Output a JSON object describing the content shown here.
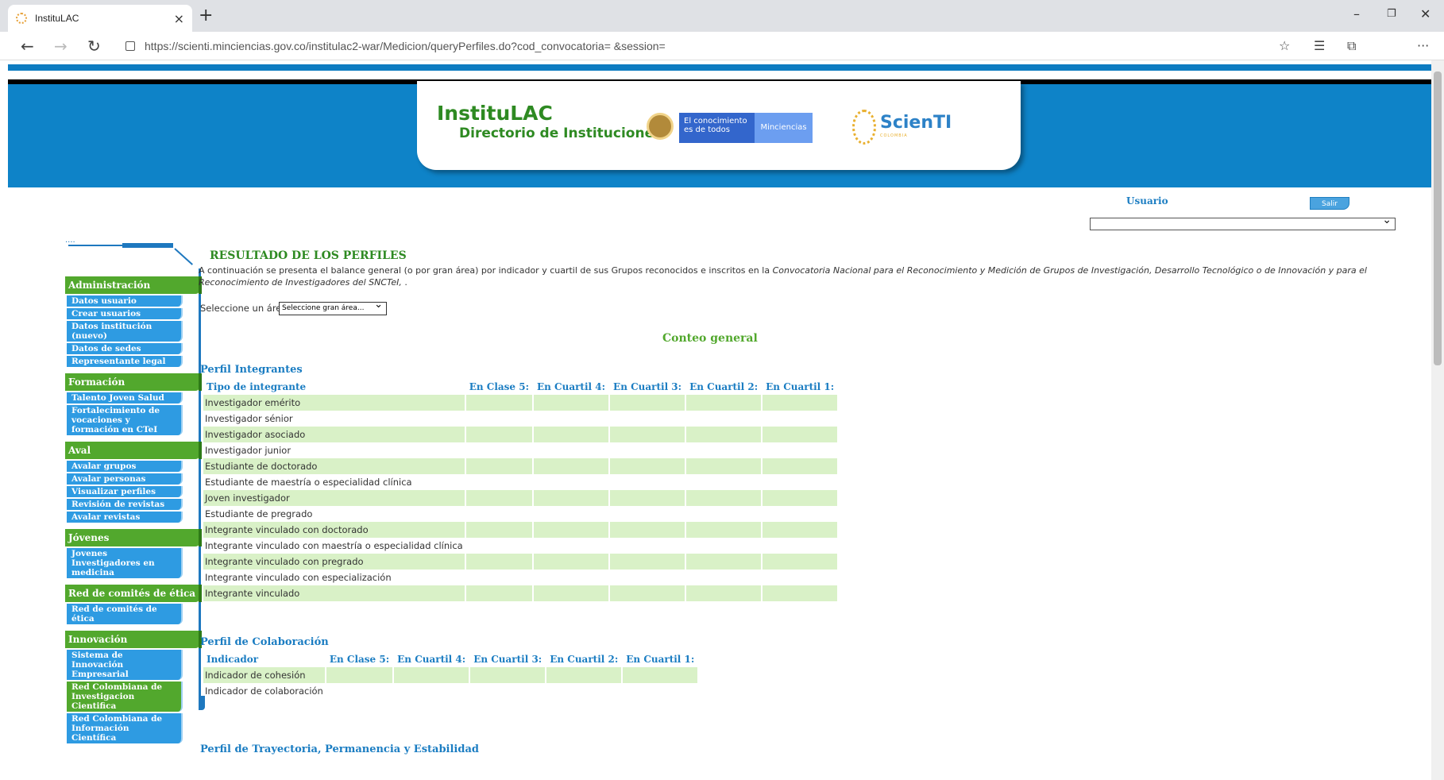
{
  "browser": {
    "tab_title": "InstituLAC",
    "tab_close": "×",
    "new_tab": "+",
    "url": "https://scienti.minciencias.gov.co/institulac2-war/Medicion/queryPerfiles.do?cod_convocatoria=    &session=",
    "back": "←",
    "forward": "→",
    "reload": "↻",
    "minimize": "–",
    "restore": "❐",
    "close": "✕",
    "more": "···"
  },
  "header": {
    "logo_main": "InstituLAC",
    "logo_sub": "Directorio de Instituciones",
    "gov_text": "El conocimiento es de todos",
    "gov_brand": "Minciencias",
    "scienti": "ScienTI",
    "scienti_sub": "COLOMBIA"
  },
  "user": {
    "label": "Usuario",
    "logout": "Salir",
    "select_value": ""
  },
  "sidebar": {
    "sections": [
      {
        "title": "Administración",
        "items": [
          {
            "label": "Datos usuario"
          },
          {
            "label": "Crear usuarios"
          },
          {
            "label": "Datos institución (nuevo)"
          },
          {
            "label": "Datos de sedes"
          },
          {
            "label": "Representante legal"
          }
        ]
      },
      {
        "title": "Formación",
        "items": [
          {
            "label": "Talento Joven Salud"
          },
          {
            "label": "Fortalecimiento de vocaciones y formación en CTeI"
          }
        ]
      },
      {
        "title": "Aval",
        "items": [
          {
            "label": "Avalar grupos"
          },
          {
            "label": "Avalar personas"
          },
          {
            "label": "Visualizar perfiles"
          },
          {
            "label": "Revisión de revistas"
          },
          {
            "label": "Avalar revistas"
          }
        ]
      },
      {
        "title": "Jóvenes",
        "items": [
          {
            "label": "Jovenes Investigadores en medicina"
          }
        ]
      },
      {
        "title": "Red de comités de ética",
        "items": [
          {
            "label": "Red de comités de ética"
          }
        ]
      },
      {
        "title": "Innovación",
        "items": [
          {
            "label": "Sistema de Innovación Empresarial"
          },
          {
            "label": "Red Colombiana de Investigacion Cientifica",
            "green": true
          },
          {
            "label": "Red Colombiana de Información Científica"
          }
        ]
      }
    ]
  },
  "main": {
    "title": "RESULTADO DE LOS PERFILES",
    "intro_plain": "A continuación se presenta el balance general (o por gran área) por indicador y cuartil de sus Grupos reconocidos e inscritos en la ",
    "intro_italic": "Convocatoria Nacional para el Reconocimiento y Medición de Grupos de Investigación, Desarrollo Tecnológico o de Innovación y para el Reconocimiento de Investigadores del SNCTeI,",
    "intro_end": "       .",
    "area_label": "Seleccione un área:",
    "area_select": "Seleccione gran área...",
    "conteo": "Conteo general"
  },
  "perfil_integrantes": {
    "title": "Perfil Integrantes",
    "headers": [
      "Tipo de integrante",
      "En Clase 5:",
      "En Cuartil 4:",
      "En Cuartil 3:",
      "En Cuartil 2:",
      "En Cuartil 1:"
    ],
    "rows": [
      "Investigador emérito",
      "Investigador sénior",
      "Investigador asociado",
      "Investigador junior",
      "Estudiante de doctorado",
      "Estudiante de maestría o especialidad clínica",
      "Joven investigador",
      "Estudiante de pregrado",
      "Integrante vinculado con doctorado",
      "Integrante vinculado con maestría o especialidad clínica",
      "Integrante vinculado con pregrado",
      "Integrante vinculado con especialización",
      "Integrante vinculado"
    ]
  },
  "perfil_colaboracion": {
    "title": "Perfil de Colaboración",
    "headers": [
      "Indicador",
      "En Clase 5:",
      "En Cuartil 4:",
      "En Cuartil 3:",
      "En Cuartil 2:",
      "En Cuartil 1:"
    ],
    "rows": [
      "Indicador de cohesión",
      "Indicador de colaboración"
    ]
  },
  "perfil_trayectoria": {
    "title": "Perfil de Trayectoria, Permanencia y Estabilidad"
  },
  "colors": {
    "brand_blue": "#0e83c8",
    "green": "#52a82d",
    "link_blue": "#1b7dc2",
    "row_shade": "#d9f1c7"
  }
}
